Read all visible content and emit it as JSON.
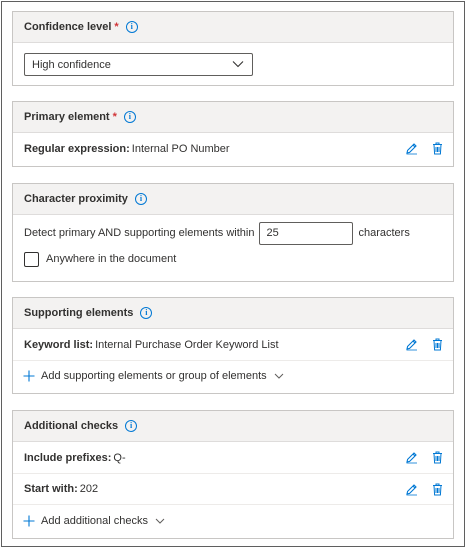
{
  "confidence": {
    "title": "Confidence level",
    "required_mark": "*",
    "info_icon": "info-icon",
    "selected": "High confidence"
  },
  "primary": {
    "title": "Primary element",
    "required_mark": "*",
    "row": {
      "label": "Regular expression:",
      "value": "Internal PO Number"
    }
  },
  "proximity": {
    "title": "Character proximity",
    "text_before": "Detect primary AND supporting elements within",
    "value": "25",
    "text_after": "characters",
    "checkbox_label": "Anywhere in the document",
    "checkbox_checked": false
  },
  "supporting": {
    "title": "Supporting elements",
    "row": {
      "label": "Keyword list:",
      "value": "Internal Purchase Order Keyword List"
    },
    "add_label": "Add supporting elements or group of elements"
  },
  "additional": {
    "title": "Additional checks",
    "rows": [
      {
        "label": "Include prefixes:",
        "value": "Q-"
      },
      {
        "label": "Start with:",
        "value": "202"
      }
    ],
    "add_label": "Add additional checks"
  },
  "colors": {
    "accent": "#0078d4",
    "required": "#d13438",
    "header_bg": "#f3f2f1",
    "border": "#c8c6c4"
  }
}
